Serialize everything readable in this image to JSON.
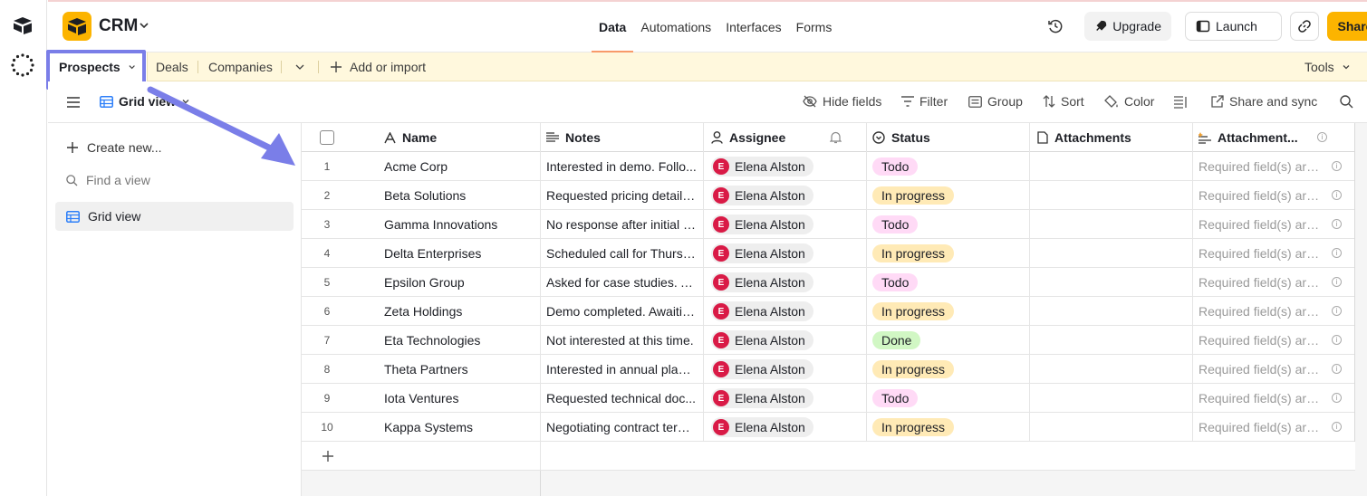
{
  "app": {
    "base_title": "CRM"
  },
  "nav": {
    "tabs": [
      "Data",
      "Automations",
      "Interfaces",
      "Forms"
    ],
    "active": "Data"
  },
  "header_actions": {
    "upgrade": "Upgrade",
    "launch": "Launch",
    "share": "Share"
  },
  "table_tabs": {
    "active": "Prospects",
    "others": [
      "Deals",
      "Companies"
    ],
    "add": "Add or import",
    "tools": "Tools"
  },
  "viewbar": {
    "view_name": "Grid view",
    "hide_fields": "Hide fields",
    "filter": "Filter",
    "group": "Group",
    "sort": "Sort",
    "color": "Color",
    "share_sync": "Share and sync"
  },
  "sidebar": {
    "create_new": "Create new...",
    "find_placeholder": "Find a view",
    "views": [
      "Grid view"
    ]
  },
  "grid": {
    "columns": [
      "Name",
      "Notes",
      "Assignee",
      "Status",
      "Attachments",
      "Attachment..."
    ],
    "rows": [
      {
        "num": "1",
        "name": "Acme Corp",
        "notes": "Interested in demo. Follo...",
        "assignee": "Elena Alston",
        "status": "Todo",
        "attsum": "Required field(s) are..."
      },
      {
        "num": "2",
        "name": "Beta Solutions",
        "notes": "Requested pricing details...",
        "assignee": "Elena Alston",
        "status": "In progress",
        "attsum": "Required field(s) are..."
      },
      {
        "num": "3",
        "name": "Gamma Innovations",
        "notes": "No response after initial c...",
        "assignee": "Elena Alston",
        "status": "Todo",
        "attsum": "Required field(s) are..."
      },
      {
        "num": "4",
        "name": "Delta Enterprises",
        "notes": "Scheduled call for Thursd...",
        "assignee": "Elena Alston",
        "status": "In progress",
        "attsum": "Required field(s) are..."
      },
      {
        "num": "5",
        "name": "Epsilon Group",
        "notes": "Asked for case studies. A...",
        "assignee": "Elena Alston",
        "status": "Todo",
        "attsum": "Required field(s) are..."
      },
      {
        "num": "6",
        "name": "Zeta Holdings",
        "notes": "Demo completed. Awaitin...",
        "assignee": "Elena Alston",
        "status": "In progress",
        "attsum": "Required field(s) are..."
      },
      {
        "num": "7",
        "name": "Eta Technologies",
        "notes": "Not interested at this time.",
        "assignee": "Elena Alston",
        "status": "Done",
        "attsum": "Required field(s) are..."
      },
      {
        "num": "8",
        "name": "Theta Partners",
        "notes": "Interested in annual plan. ...",
        "assignee": "Elena Alston",
        "status": "In progress",
        "attsum": "Required field(s) are..."
      },
      {
        "num": "9",
        "name": "Iota Ventures",
        "notes": "Requested technical doc...",
        "assignee": "Elena Alston",
        "status": "Todo",
        "attsum": "Required field(s) are..."
      },
      {
        "num": "10",
        "name": "Kappa Systems",
        "notes": "Negotiating contract term...",
        "assignee": "Elena Alston",
        "status": "In progress",
        "attsum": "Required field(s) are..."
      }
    ]
  },
  "colors": {
    "brand": "#fcb400",
    "highlight": "#7a7ee8",
    "avatar": "#d91a46"
  }
}
